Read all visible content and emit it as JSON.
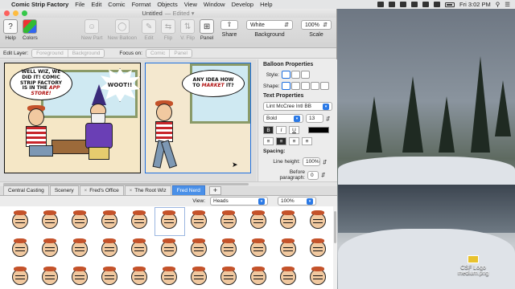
{
  "menubar": {
    "app_name": "Comic Strip Factory",
    "items": [
      "File",
      "Edit",
      "Comic",
      "Format",
      "Objects",
      "View",
      "Window",
      "Develop",
      "Help"
    ],
    "clock": "Fri 3:02 PM"
  },
  "window": {
    "title": "Untitled",
    "title_suffix": "— Edited ▾"
  },
  "toolbar": {
    "help": "Help",
    "colors": "Colors",
    "new_part": "New Part",
    "new_balloon": "New Balloon",
    "edit": "Edit",
    "flip": "Flip",
    "v_flip": "V. Flip",
    "panel": "Panel",
    "share": "Share",
    "background_value": "White",
    "background_label": "Background",
    "scale_value": "100%",
    "scale_label": "Scale"
  },
  "editbar": {
    "edit_layer_label": "Edit Layer:",
    "foreground": "Foreground",
    "background": "Background",
    "focus_on_label": "Focus on:",
    "comic": "Comic",
    "panel": "Panel"
  },
  "comic": {
    "panel1_balloon": "WELL WIZ, WE DID IT! COMIC STRIP FACTORY IS IN THE",
    "panel1_balloon_emph": "APP STORE!",
    "panel1_burst": "WOOT!!",
    "panel2_balloon": "ANY IDEA HOW TO",
    "panel2_balloon_emph": "MARKET",
    "panel2_balloon_end": "IT?"
  },
  "inspector": {
    "balloon_properties": "Balloon Properties",
    "style_label": "Style:",
    "shape_label": "Shape:",
    "text_properties": "Text Properties",
    "font_name": "Lint McCree Intl BB",
    "font_weight": "Bold",
    "font_size": "13",
    "bold_btn": "B",
    "italic_btn": "I",
    "underline_btn": "U",
    "text_color": "#000000",
    "spacing_label": "Spacing:",
    "line_height_label": "Line height:",
    "line_height_value": "100%",
    "before_paragraph_label": "Before paragraph:",
    "before_paragraph_value": "0"
  },
  "tabs": [
    {
      "label": "Central Casting",
      "active": false
    },
    {
      "label": "Scenery",
      "active": false
    },
    {
      "label": "Fred's Office",
      "active": false
    },
    {
      "label": "The Root Wiz",
      "active": false
    },
    {
      "label": "Fred Nerd",
      "active": true
    }
  ],
  "tab_add": "+",
  "view": {
    "label": "View:",
    "selected": "Heads",
    "zoom": "100%"
  },
  "desktop": {
    "file_name": "CSF Logo",
    "file_ext": "medium.png"
  },
  "colors": {
    "accent": "#2a79e6",
    "active_tab": "#4a90e8",
    "panel_selected_border": "#1d6fe0"
  }
}
